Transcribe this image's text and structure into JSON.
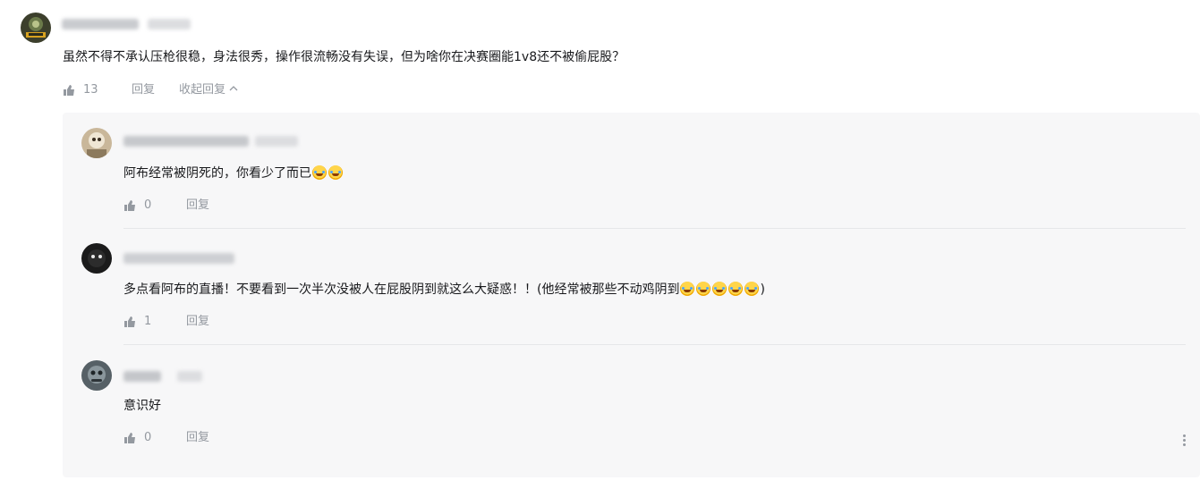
{
  "main_comment": {
    "text": "虽然不得不承认压枪很稳，身法很秀，操作很流畅没有失误，但为啥你在决赛圈能1v8还不被偷屁股？",
    "likes": "13",
    "reply_label": "回复",
    "collapse_label": "收起回复",
    "collapse_icon": "chevron-up-icon"
  },
  "replies": [
    {
      "text": "阿布经常被阴死的，你看少了而已",
      "emoji_count": 2,
      "likes": "0",
      "reply_label": "回复"
    },
    {
      "text": "多点看阿布的直播！不要看到一次半次没被人在屁股阴到就这么大疑惑！！(他经常被那些不动鸡阴到",
      "text_suffix": ")",
      "emoji_count": 5,
      "likes": "1",
      "reply_label": "回复"
    },
    {
      "text": "意识好",
      "emoji_count": 0,
      "likes": "0",
      "reply_label": "回复"
    }
  ],
  "icons": {
    "like": "thumbs-up-icon",
    "more": "more-vertical-icon"
  },
  "colors": {
    "text": "#18191c",
    "meta": "#9499a0",
    "reply_bg": "#f7f7f8"
  }
}
